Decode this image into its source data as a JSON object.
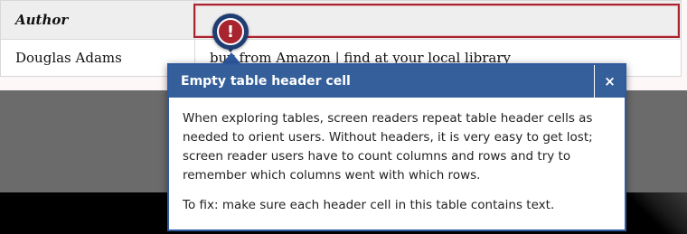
{
  "table": {
    "headers": [
      "Author",
      ""
    ],
    "rows": [
      [
        "Douglas Adams",
        "buy from Amazon | find at your local library"
      ]
    ]
  },
  "marker": {
    "icon": "exclamation-icon",
    "glyph": "!",
    "color": "#a8242f"
  },
  "popup": {
    "title": "Empty table header cell",
    "close_label": "×",
    "paragraphs": [
      "When exploring tables, screen readers repeat table header cells as needed to orient users. Without headers, it is very easy to get lost; screen reader users have to count columns and rows and try to remember which columns went with which rows.",
      "To fix: make sure each header cell in this table contains text."
    ],
    "header_color": "#345f9a"
  }
}
